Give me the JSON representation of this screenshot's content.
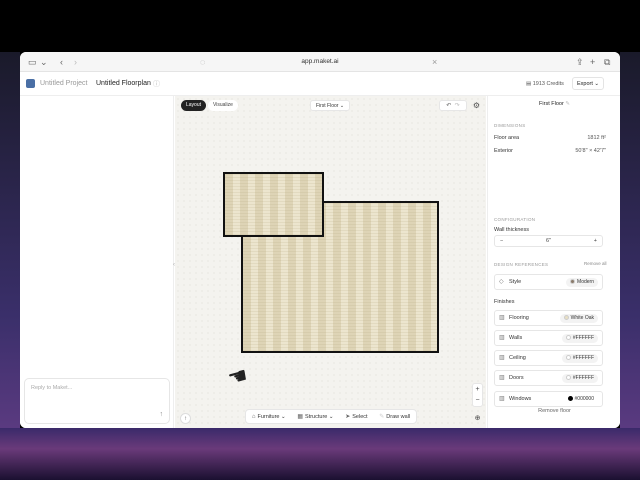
{
  "browser": {
    "url": "app.maket.ai"
  },
  "header": {
    "project": "Untitled Project",
    "floorplan": "Untitled Floorplan",
    "credits": "1913 Credits",
    "export_label": "Export"
  },
  "canvas": {
    "view_tabs": [
      "Layout",
      "Visualize"
    ],
    "active_tab": "Layout",
    "floor_select": "First Floor",
    "toolbar": {
      "furniture": "Furniture",
      "structure": "Structure",
      "select": "Select",
      "draw_wall": "Draw wall"
    }
  },
  "chat": {
    "placeholder": "Reply to Maket..."
  },
  "panel": {
    "title": "First Floor",
    "dimensions_label": "DIMENSIONS",
    "floor_area_label": "Floor area",
    "floor_area_value": "1812 ft²",
    "exterior_label": "Exterior",
    "exterior_value": "50'8\" × 42'7\"",
    "configuration_label": "CONFIGURATION",
    "wall_thickness_label": "Wall thickness",
    "wall_thickness_value": "6\"",
    "design_refs_label": "DESIGN REFERENCES",
    "remove_all": "Remove all",
    "style_label": "Style",
    "style_value": "Modern",
    "finishes_label": "Finishes",
    "finishes": [
      {
        "label": "Flooring",
        "value": "White Oak",
        "color": "#e8dfc4"
      },
      {
        "label": "Walls",
        "value": "#FFFFFF",
        "color": "#ffffff"
      },
      {
        "label": "Ceiling",
        "value": "#FFFFFF",
        "color": "#ffffff"
      },
      {
        "label": "Doors",
        "value": "#FFFFFF",
        "color": "#ffffff"
      },
      {
        "label": "Windows",
        "value": "#000000",
        "color": "#000000"
      }
    ],
    "remove_floor": "Remove floor"
  }
}
